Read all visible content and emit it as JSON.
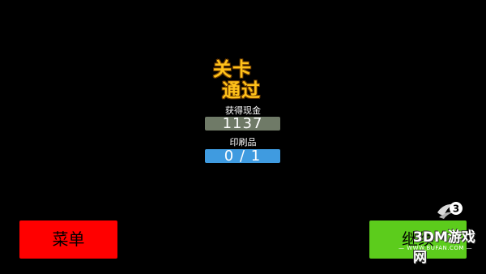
{
  "title": {
    "line1": "关卡",
    "line2": "通过"
  },
  "stats": {
    "cash_label": "获得现金",
    "cash_value": "1137",
    "print_label": "印刷品",
    "print_value": "0 / 1"
  },
  "buttons": {
    "menu": "菜单",
    "continue": "继续"
  },
  "watermark": {
    "text": "3DM游戏网",
    "url": "— WWW.BUFAN.COM —"
  },
  "colors": {
    "title": "#ffc21a",
    "cash_bar": "#6f7a67",
    "print_bar": "#3f9be0",
    "menu_button": "#ff0000",
    "continue_button": "#5ccc1c"
  }
}
